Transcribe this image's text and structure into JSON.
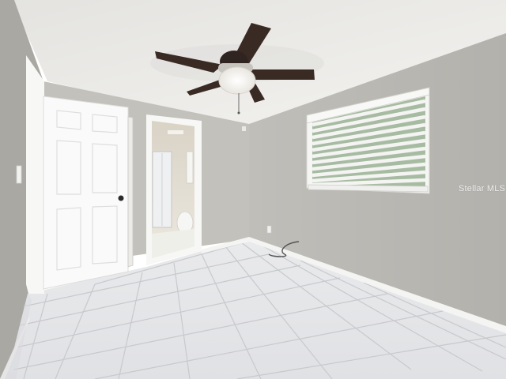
{
  "watermark": {
    "text": "Stellar MLS"
  },
  "colors": {
    "ceiling": "#ecebe8",
    "right_wall": "#b9b7b2",
    "back_wall": "#c3c1bc",
    "left_wall": "#a9a7a2",
    "floor_tile": "#e6e7ea",
    "grout": "#c9cace",
    "baseboard": "#f4f4f2",
    "door": "#fafafa",
    "trim": "#f7f7f5",
    "fan_blade": "#3a2a24",
    "blind": "#f2f2f0",
    "window_view": "#9fb69a",
    "bathroom": "#e2dccf"
  }
}
